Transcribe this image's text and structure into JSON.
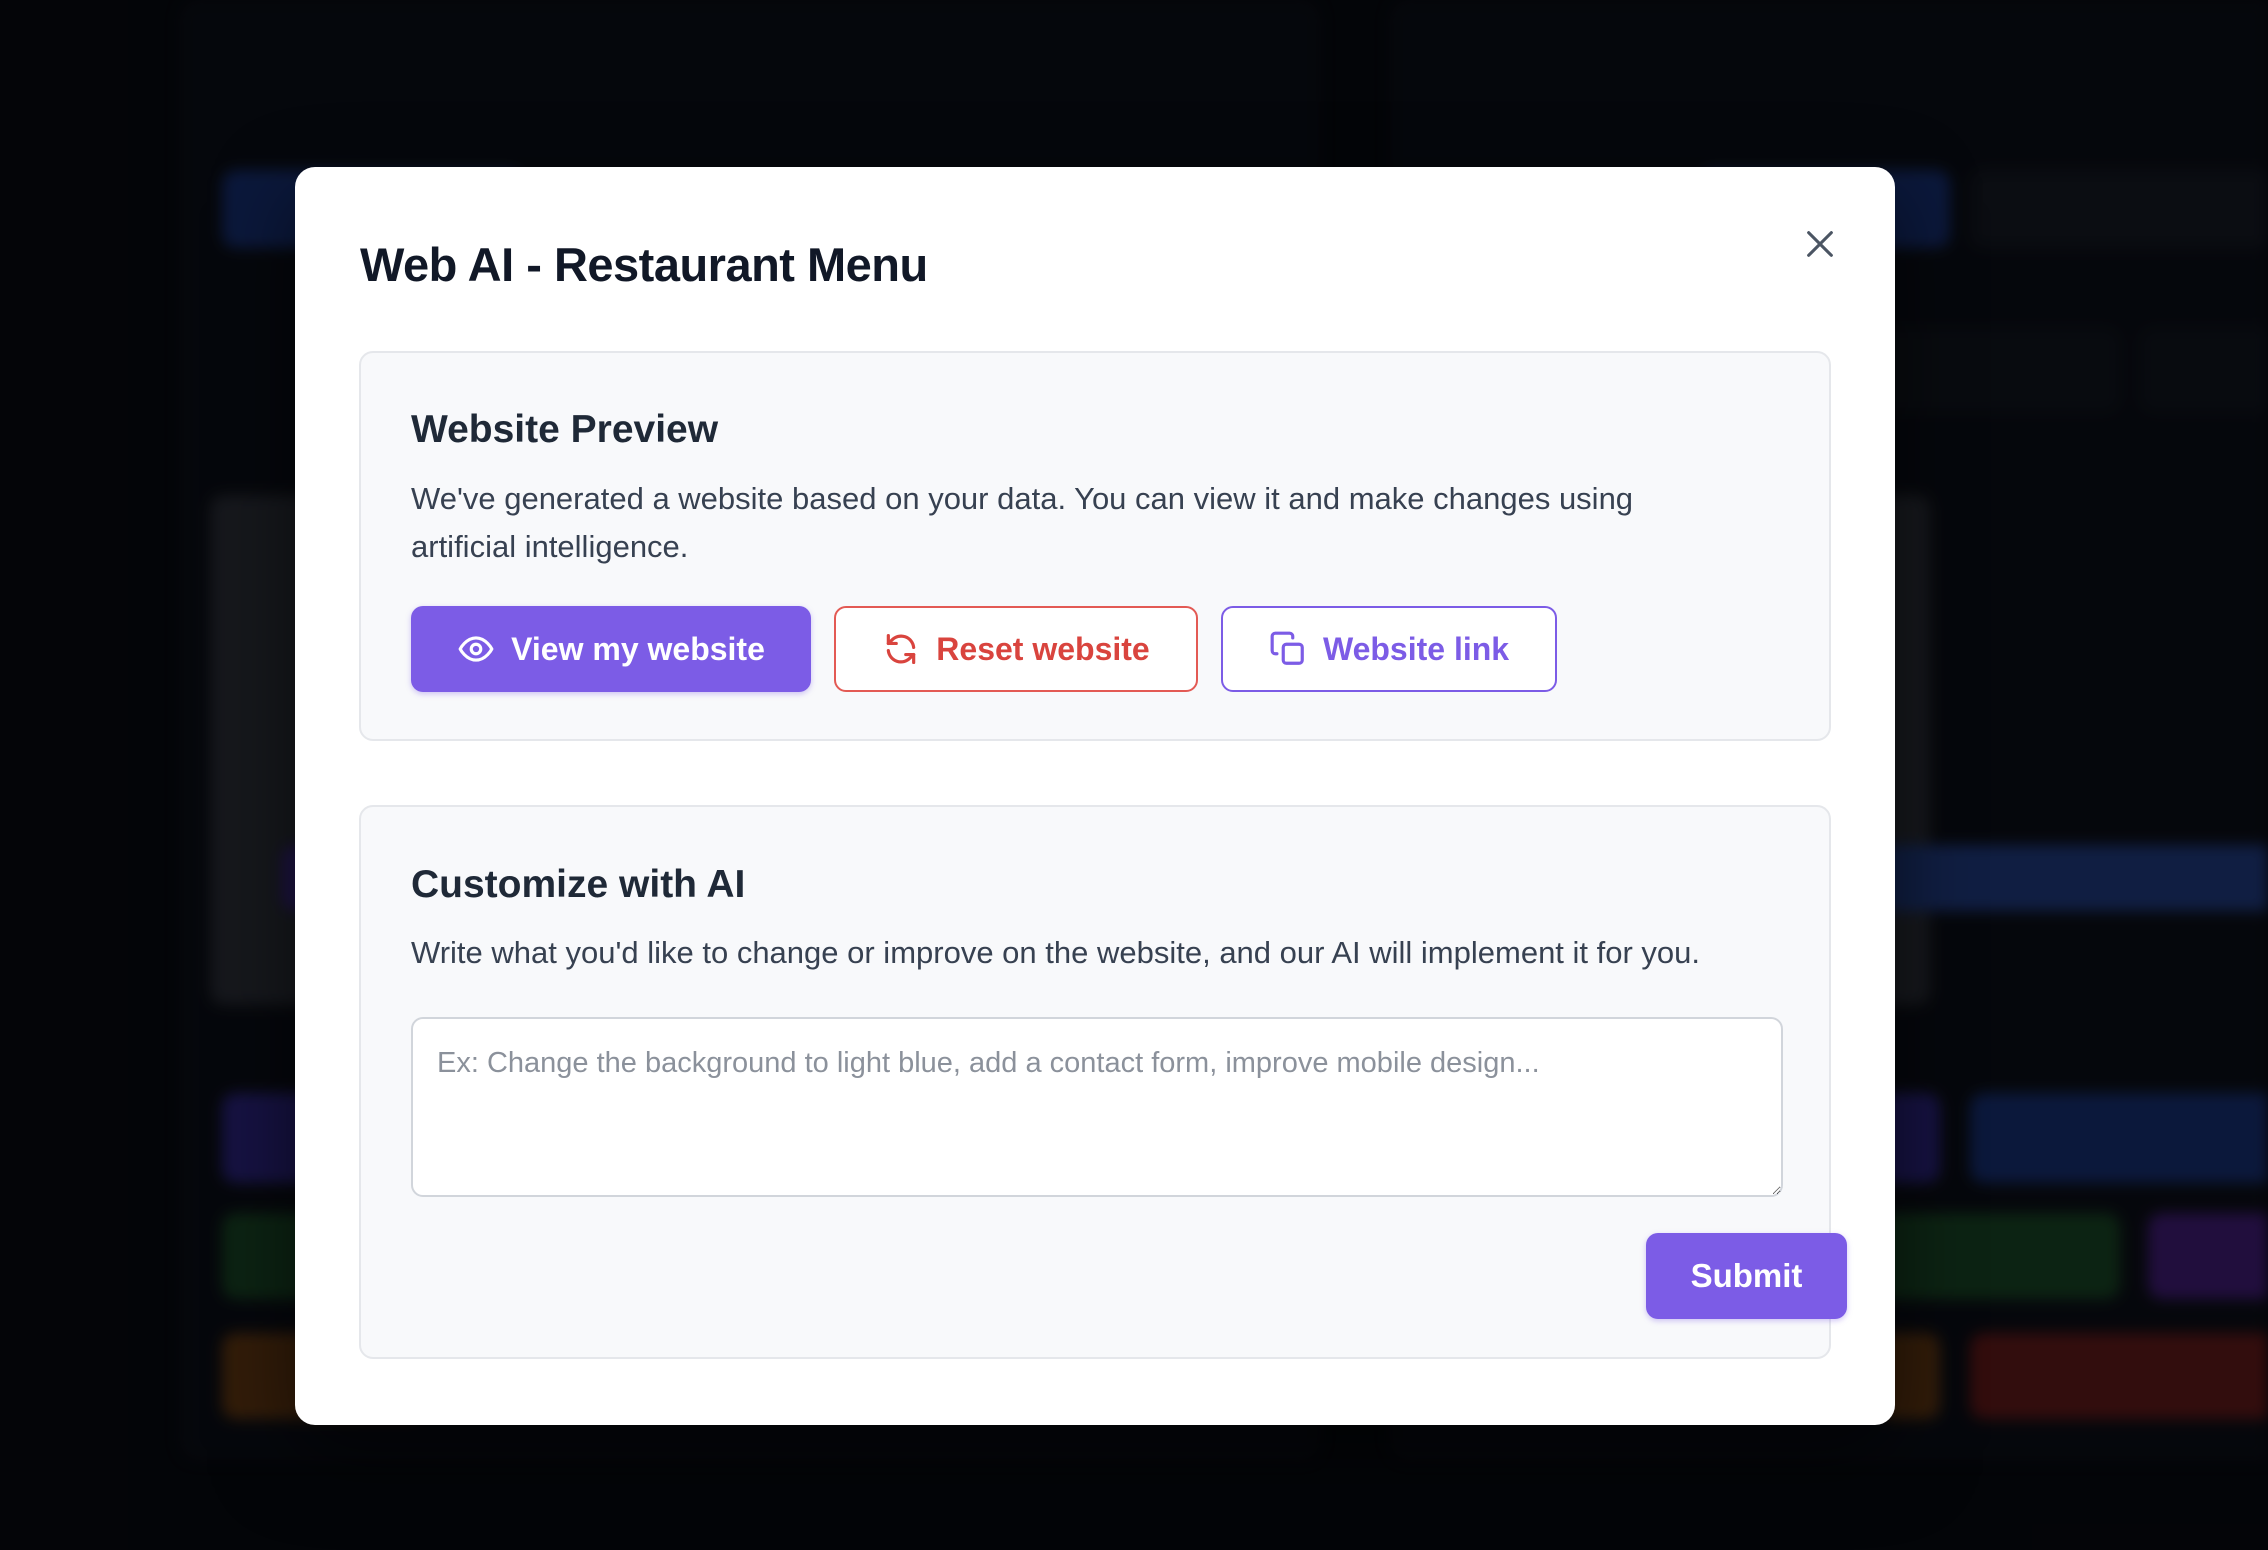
{
  "modal": {
    "title": "Web AI - Restaurant Menu",
    "preview": {
      "title": "Website Preview",
      "description": "We've generated a website based on your data. You can view it and make changes using artificial intelligence.",
      "view_label": "View my website",
      "reset_label": "Reset website",
      "link_label": "Website link"
    },
    "customize": {
      "title": "Customize with AI",
      "description": "Write what you'd like to change or improve on the website, and our AI will implement it for you.",
      "prompt_value": "",
      "prompt_placeholder": "Ex: Change the background to light blue, add a contact form, improve mobile design...",
      "submit_label": "Submit"
    }
  },
  "icons": {
    "close": "close-icon",
    "view": "eye-icon",
    "reset": "refresh-icon",
    "link": "copy-icon"
  },
  "colors": {
    "accent": "#7c5ce6",
    "danger": "#d9443e",
    "title": "#111827",
    "card_bg": "#f8f9fb"
  }
}
